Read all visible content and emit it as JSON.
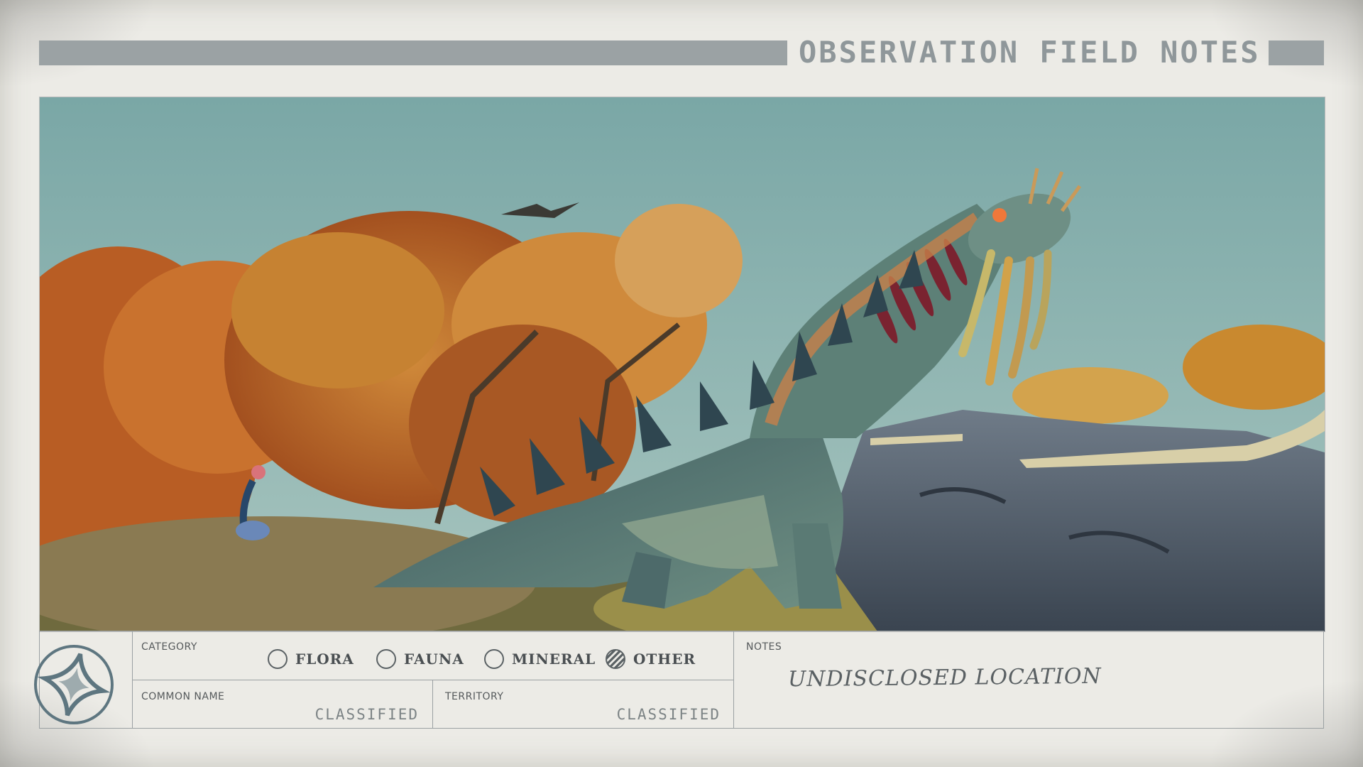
{
  "header": {
    "title": "OBSERVATION FIELD NOTES"
  },
  "photo": {
    "subject_icon": "alien-creature-image"
  },
  "emblem": {
    "icon": "constellation-star-emblem-icon"
  },
  "category": {
    "label": "CATEGORY",
    "options": [
      {
        "label": "FLORA",
        "checked": false
      },
      {
        "label": "FAUNA",
        "checked": false
      },
      {
        "label": "MINERAL",
        "checked": false
      },
      {
        "label": "OTHER",
        "checked": true
      }
    ]
  },
  "common_name": {
    "label": "COMMON NAME",
    "value": "CLASSIFIED"
  },
  "territory": {
    "label": "TERRITORY",
    "value": "CLASSIFIED"
  },
  "notes": {
    "label": "NOTES",
    "value": "UNDISCLOSED LOCATION"
  },
  "colors": {
    "paper": "#ecebe6",
    "title_bar": "#9ba2a4",
    "sky": "#86b0ae",
    "foliage": "#c4732e",
    "creature": "#4f6e6c"
  }
}
